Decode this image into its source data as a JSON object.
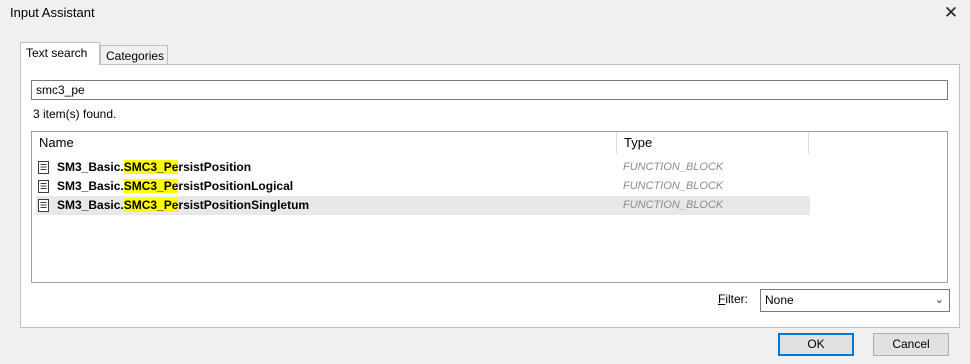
{
  "window": {
    "title": "Input Assistant",
    "close_glyph": "✕"
  },
  "tabs": [
    {
      "label": "Text search",
      "active": true
    },
    {
      "label": "Categories",
      "active": false
    }
  ],
  "search": {
    "value": "smc3_pe"
  },
  "status": {
    "found_text": "3 item(s) found."
  },
  "list": {
    "columns": {
      "name": "Name",
      "type": "Type"
    },
    "rows": [
      {
        "prefix": "SM3_Basic.",
        "highlight": "SMC3_Pe",
        "suffix": "rsistPosition",
        "type": "FUNCTION_BLOCK",
        "selected": false,
        "icon": "document-icon"
      },
      {
        "prefix": "SM3_Basic.",
        "highlight": "SMC3_Pe",
        "suffix": "rsistPositionLogical",
        "type": "FUNCTION_BLOCK",
        "selected": false,
        "icon": "document-icon"
      },
      {
        "prefix": "SM3_Basic.",
        "highlight": "SMC3_Pe",
        "suffix": "rsistPositionSingletum",
        "type": "FUNCTION_BLOCK",
        "selected": true,
        "icon": "document-icon"
      }
    ]
  },
  "filter": {
    "label_mnemonic": "F",
    "label_rest": "ilter:",
    "selected": "None"
  },
  "buttons": {
    "ok": "OK",
    "cancel": "Cancel"
  },
  "colors": {
    "highlight": "#ffff00",
    "selected_row": "#e8e8e8",
    "default_button_border": "#0078d7"
  }
}
